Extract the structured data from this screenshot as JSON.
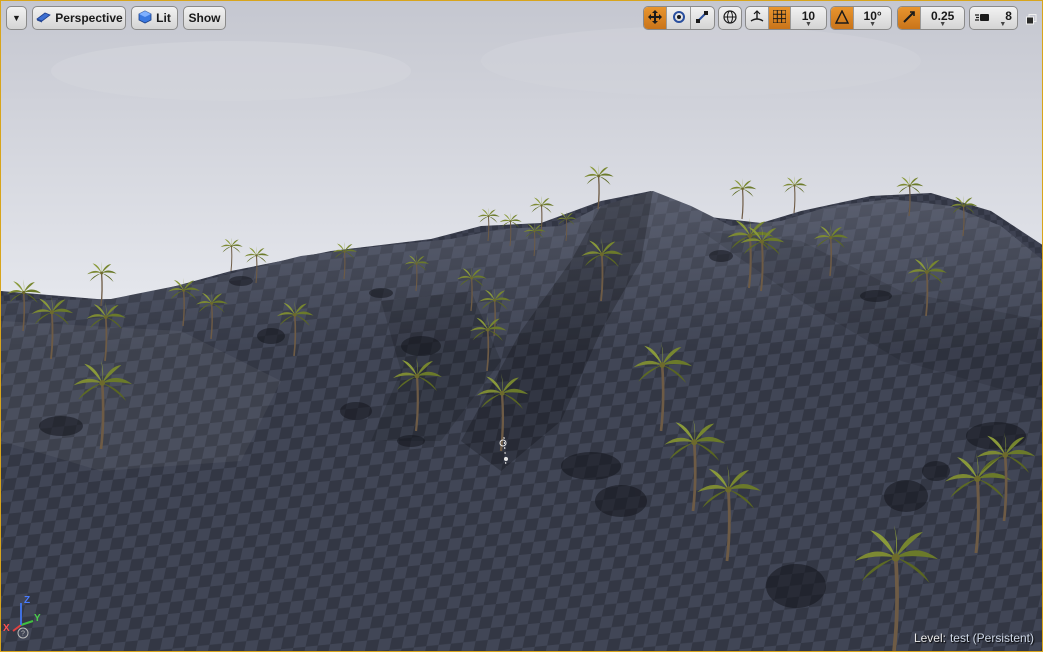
{
  "toolbar": {
    "view_mode_label": "Perspective",
    "lit_label": "Lit",
    "show_label": "Show",
    "grid_snap_value": "10",
    "rotation_snap_value": "10°",
    "scale_snap_value": "0.25",
    "camera_speed_value": "8"
  },
  "status": {
    "level_label": "Level:",
    "level_value": "test (Persistent)"
  },
  "gizmo": {
    "x_label": "X",
    "y_label": "Y",
    "z_label": "Z"
  },
  "colors": {
    "accent_orange": "#d8861f",
    "sky_top": "#c9ccd6",
    "terrain": "#3d4150",
    "palm_leaf": "#6f7a2c"
  }
}
